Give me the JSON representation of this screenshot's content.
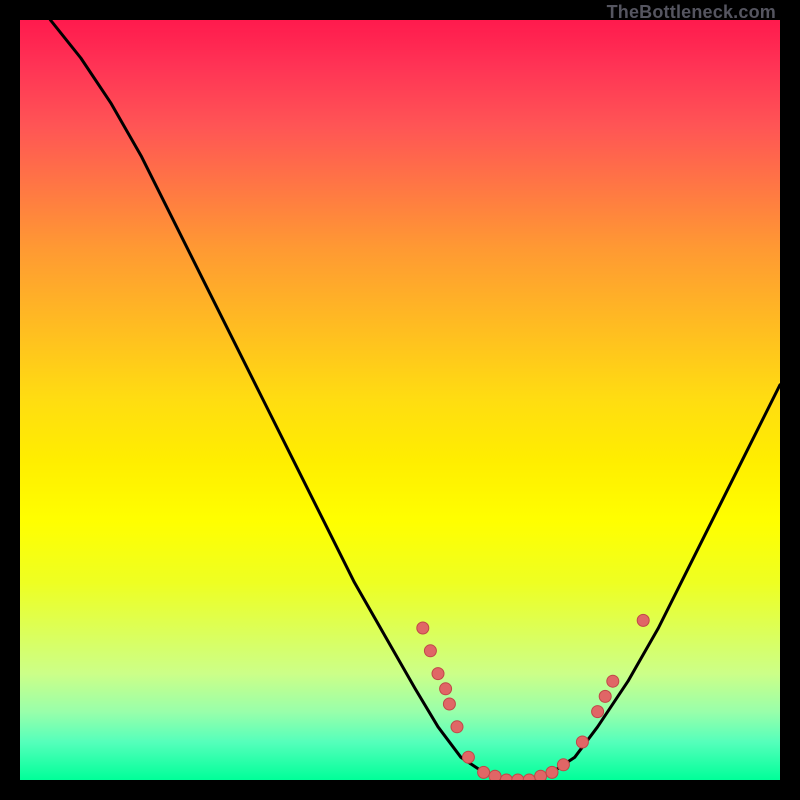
{
  "attribution": "TheBottleneck.com",
  "colors": {
    "curve": "#000000",
    "dot_fill": "#e06666",
    "dot_stroke": "#c04848"
  },
  "chart_data": {
    "type": "line",
    "title": "",
    "xlabel": "",
    "ylabel": "",
    "xlim": [
      0,
      100
    ],
    "ylim": [
      0,
      100
    ],
    "curve": [
      {
        "x": 4,
        "y": 100
      },
      {
        "x": 8,
        "y": 95
      },
      {
        "x": 12,
        "y": 89
      },
      {
        "x": 16,
        "y": 82
      },
      {
        "x": 20,
        "y": 74
      },
      {
        "x": 24,
        "y": 66
      },
      {
        "x": 28,
        "y": 58
      },
      {
        "x": 32,
        "y": 50
      },
      {
        "x": 36,
        "y": 42
      },
      {
        "x": 40,
        "y": 34
      },
      {
        "x": 44,
        "y": 26
      },
      {
        "x": 48,
        "y": 19
      },
      {
        "x": 52,
        "y": 12
      },
      {
        "x": 55,
        "y": 7
      },
      {
        "x": 58,
        "y": 3
      },
      {
        "x": 61,
        "y": 1
      },
      {
        "x": 64,
        "y": 0
      },
      {
        "x": 67,
        "y": 0
      },
      {
        "x": 70,
        "y": 1
      },
      {
        "x": 73,
        "y": 3
      },
      {
        "x": 76,
        "y": 7
      },
      {
        "x": 80,
        "y": 13
      },
      {
        "x": 84,
        "y": 20
      },
      {
        "x": 88,
        "y": 28
      },
      {
        "x": 92,
        "y": 36
      },
      {
        "x": 96,
        "y": 44
      },
      {
        "x": 100,
        "y": 52
      }
    ],
    "points": [
      {
        "x": 53,
        "y": 20
      },
      {
        "x": 54,
        "y": 17
      },
      {
        "x": 55,
        "y": 14
      },
      {
        "x": 56,
        "y": 12
      },
      {
        "x": 56.5,
        "y": 10
      },
      {
        "x": 57.5,
        "y": 7
      },
      {
        "x": 59,
        "y": 3
      },
      {
        "x": 61,
        "y": 1
      },
      {
        "x": 62.5,
        "y": 0.5
      },
      {
        "x": 64,
        "y": 0
      },
      {
        "x": 65.5,
        "y": 0
      },
      {
        "x": 67,
        "y": 0
      },
      {
        "x": 68.5,
        "y": 0.5
      },
      {
        "x": 70,
        "y": 1
      },
      {
        "x": 71.5,
        "y": 2
      },
      {
        "x": 74,
        "y": 5
      },
      {
        "x": 76,
        "y": 9
      },
      {
        "x": 77,
        "y": 11
      },
      {
        "x": 78,
        "y": 13
      },
      {
        "x": 82,
        "y": 21
      }
    ]
  }
}
